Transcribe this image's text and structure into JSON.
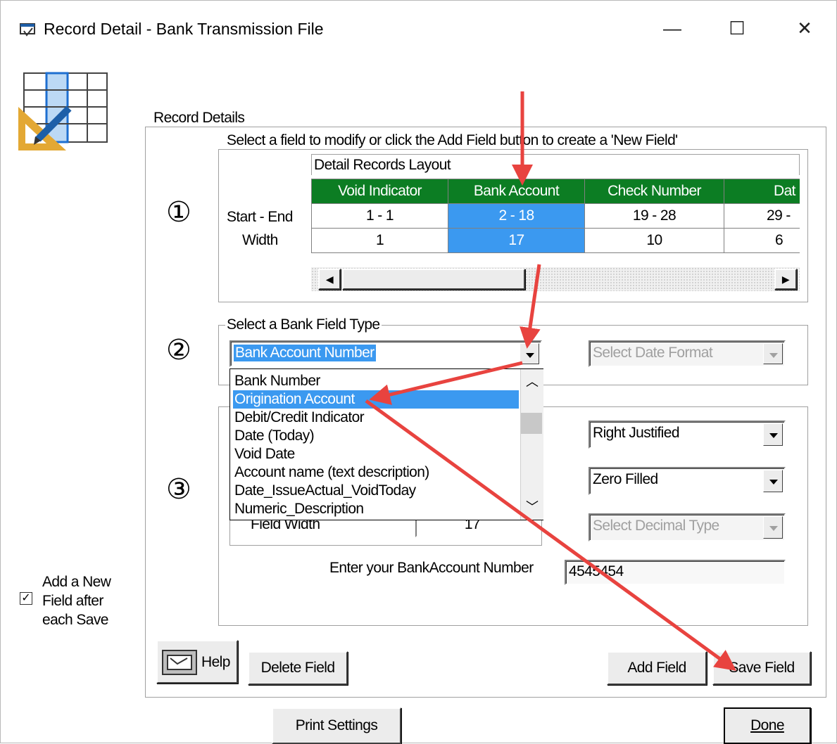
{
  "window": {
    "title": "Record Detail - Bank Transmission File",
    "minimize": "—",
    "maximize": "☐",
    "close": "✕"
  },
  "record_details": {
    "legend": "Record Details",
    "select_field": {
      "legend": "Select a field to modify or click the Add Field button to create a 'New Field'",
      "step": "①",
      "layout_label": "Detail Records Layout",
      "row_labels": {
        "start_end": "Start - End",
        "width": "Width"
      },
      "columns": [
        {
          "header": "Void Indicator",
          "start_end": "1 - 1",
          "width": "1"
        },
        {
          "header": "Bank Account",
          "start_end": "2 - 18",
          "width": "17"
        },
        {
          "header": "Check Number",
          "start_end": "19 - 28",
          "width": "10"
        },
        {
          "header": "Dat",
          "start_end": "29 -",
          "width": "6"
        }
      ],
      "selected_column": "Bank Account"
    },
    "bank_field_type": {
      "legend": "Select a Bank Field Type",
      "step": "②",
      "selected": "Bank Account Number",
      "date_format_placeholder": "Select Date Format",
      "options": [
        "Bank Number",
        "Origination Account",
        "Debit/Credit Indicator",
        "Date (Today)",
        "Void Date",
        "Account name (text description)",
        "Date_IssueActual_VoidToday",
        "Numeric_Description"
      ],
      "highlighted_option": "Origination Account"
    },
    "format": {
      "step": "③",
      "justification": "Right Justified",
      "fill": "Zero Filled",
      "decimal_placeholder": "Select Decimal Type",
      "field_width_label": "Field Width",
      "field_width_value": "17",
      "account_label": "Enter your BankAccount Number",
      "account_value": "4545454"
    }
  },
  "add_new_field": {
    "label_lines": [
      "Add a New",
      "Field after",
      "each Save"
    ],
    "checked": true
  },
  "buttons": {
    "help": "Help",
    "delete_field": "Delete Field",
    "add_field": "Add Field",
    "save_field": "Save Field",
    "print_settings": "Print Settings",
    "done": "Done"
  },
  "colors": {
    "header_green": "#0c7d23",
    "selection_blue": "#3b99f0",
    "arrow_red": "#e8433f"
  }
}
